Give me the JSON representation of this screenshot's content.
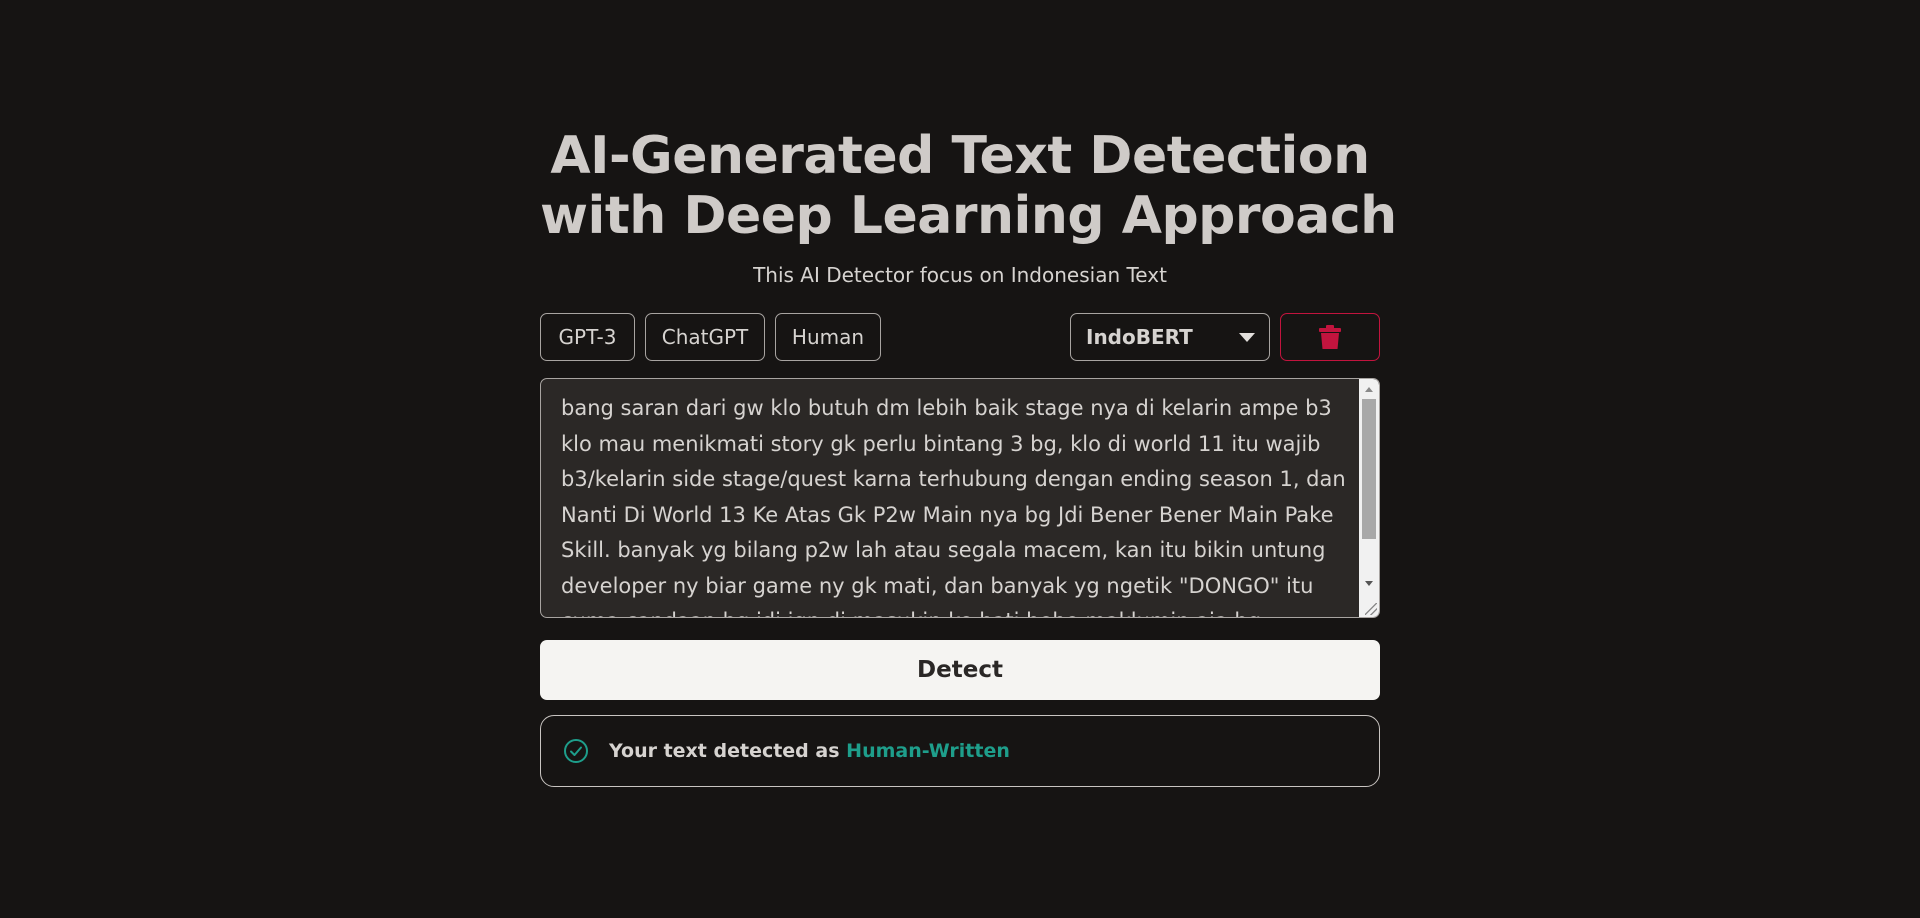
{
  "header": {
    "title_line1": "AI-Generated Text Detection",
    "title_line2": "with Deep Learning Approach",
    "subtitle": "This AI Detector focus on Indonesian Text"
  },
  "toolbar": {
    "samples": [
      "GPT-3",
      "ChatGPT",
      "Human"
    ],
    "model_select": {
      "selected": "IndoBERT"
    },
    "clear_icon": "trash-icon"
  },
  "input": {
    "text": "bang saran dari gw klo butuh dm lebih baik stage nya di kelarin ampe b3 klo mau menikmati story gk perlu bintang 3 bg, klo di world 11 itu wajib b3/kelarin side stage/quest karna terhubung dengan ending season 1, dan Nanti Di World 13 Ke Atas Gk P2w Main nya bg Jdi Bener Bener Main Pake Skill. banyak yg bilang p2w lah atau segala macem, kan itu bikin untung developer ny biar game ny gk mati, dan banyak yg ngetik \"DONGO\" itu cuma candaan bg jdi jgn di masukin ke hati hehe maklumin aja bg kebanyakan bocil"
  },
  "actions": {
    "detect_label": "Detect"
  },
  "result": {
    "icon": "check-circle-icon",
    "prefix": "Your text detected as",
    "value": "Human-Written"
  },
  "colors": {
    "background": "#161413",
    "accent_result": "#1e9e8b",
    "danger": "#c2143e"
  }
}
